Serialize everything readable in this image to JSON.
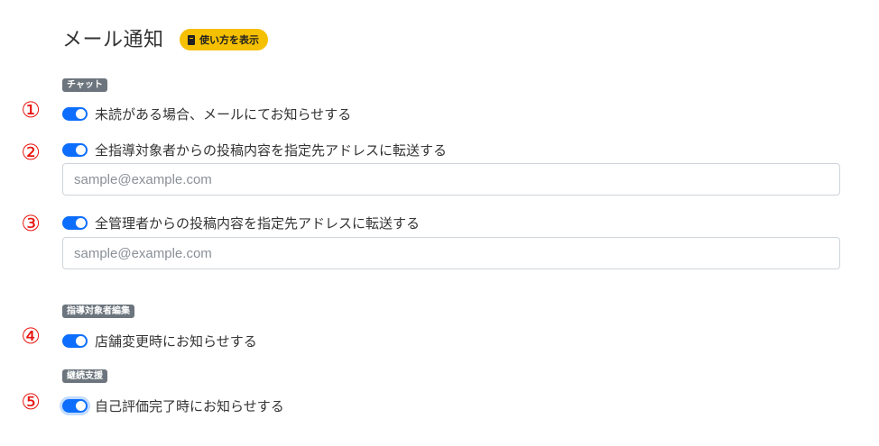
{
  "header": {
    "title": "メール通知",
    "help_label": "使い方を表示"
  },
  "sections": [
    {
      "badge": "チャット"
    },
    {
      "badge": "指導対象者編集"
    },
    {
      "badge": "継続支援"
    }
  ],
  "markers": [
    "①",
    "②",
    "③",
    "④",
    "⑤"
  ],
  "settings": [
    {
      "label": "未読がある場合、メールにてお知らせする",
      "enabled": true
    },
    {
      "label": "全指導対象者からの投稿内容を指定先アドレスに転送する",
      "enabled": true,
      "input_placeholder": "sample@example.com"
    },
    {
      "label": "全管理者からの投稿内容を指定先アドレスに転送する",
      "enabled": true,
      "input_placeholder": "sample@example.com"
    },
    {
      "label": "店舗変更時にお知らせする",
      "enabled": true
    },
    {
      "label": "自己評価完了時にお知らせする",
      "enabled": true
    }
  ]
}
